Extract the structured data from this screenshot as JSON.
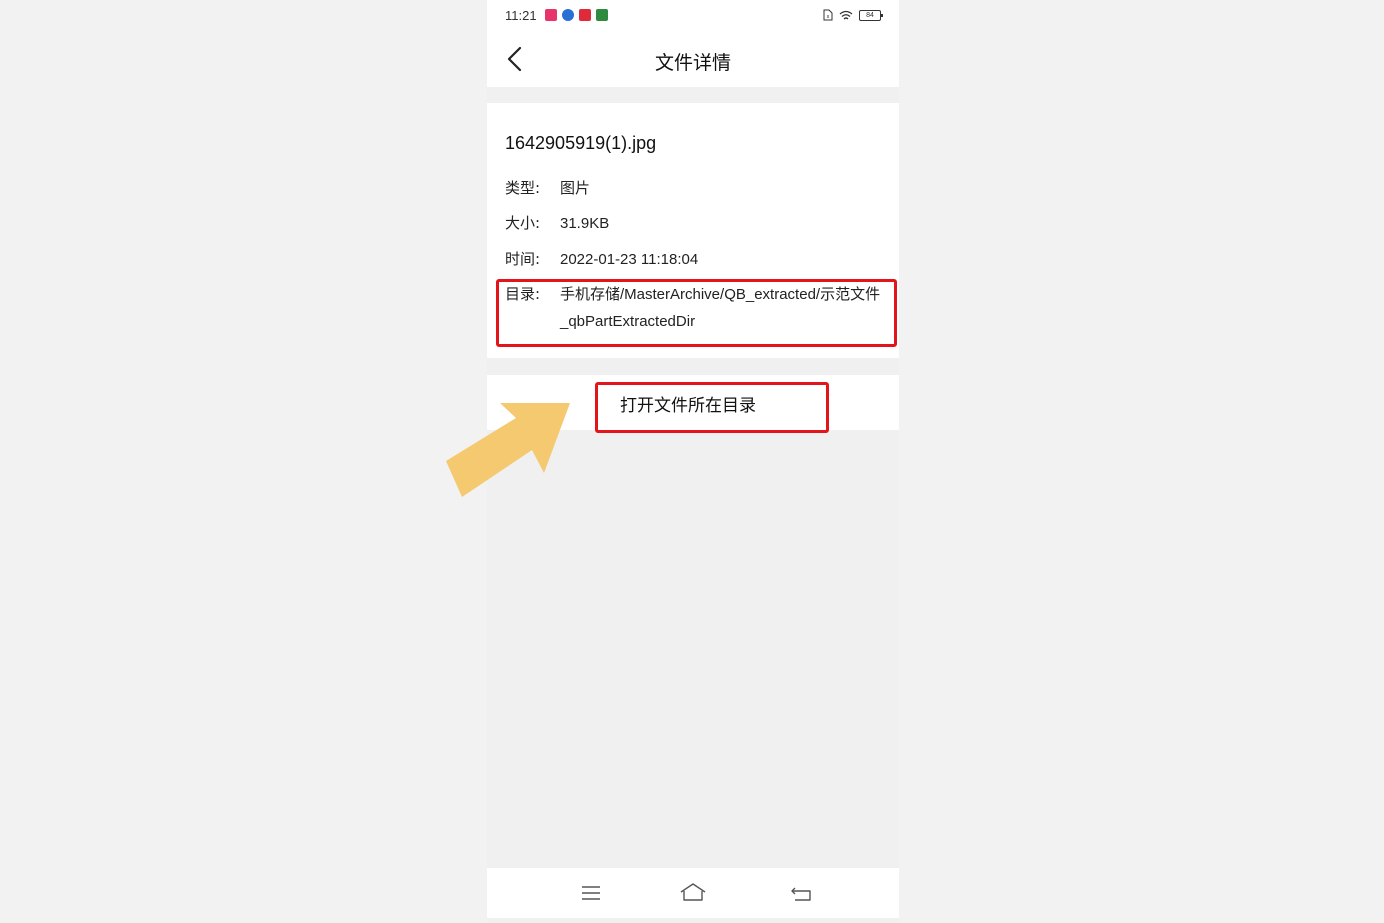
{
  "status_bar": {
    "time": "11:21",
    "notification_icons": [
      {
        "name": "app-notif-1-icon",
        "color": "#e8336b",
        "glyph": "■"
      },
      {
        "name": "app-notif-2-icon",
        "color": "#2a6fd6",
        "glyph": "●"
      },
      {
        "name": "app-notif-3-icon",
        "color": "#e02a3a",
        "glyph": "■"
      },
      {
        "name": "app-notif-4-icon",
        "color": "#2d8a3e",
        "glyph": "■"
      }
    ],
    "battery_level": "84"
  },
  "header": {
    "title": "文件详情"
  },
  "file": {
    "name": "1642905919(1).jpg",
    "type_label": "类型:",
    "type_value": "图片",
    "size_label": "大小:",
    "size_value": "31.9KB",
    "time_label": "时间:",
    "time_value": "2022-01-23 11:18:04",
    "dir_label": "目录:",
    "dir_value": "手机存储/MasterArchive/QB_extracted/示范文件_qbPartExtractedDir"
  },
  "actions": {
    "open_directory_label": "打开文件所在目录"
  },
  "colors": {
    "highlight": "#e4141b",
    "arrow": "#f5c96f",
    "background": "#f0f0f0"
  }
}
